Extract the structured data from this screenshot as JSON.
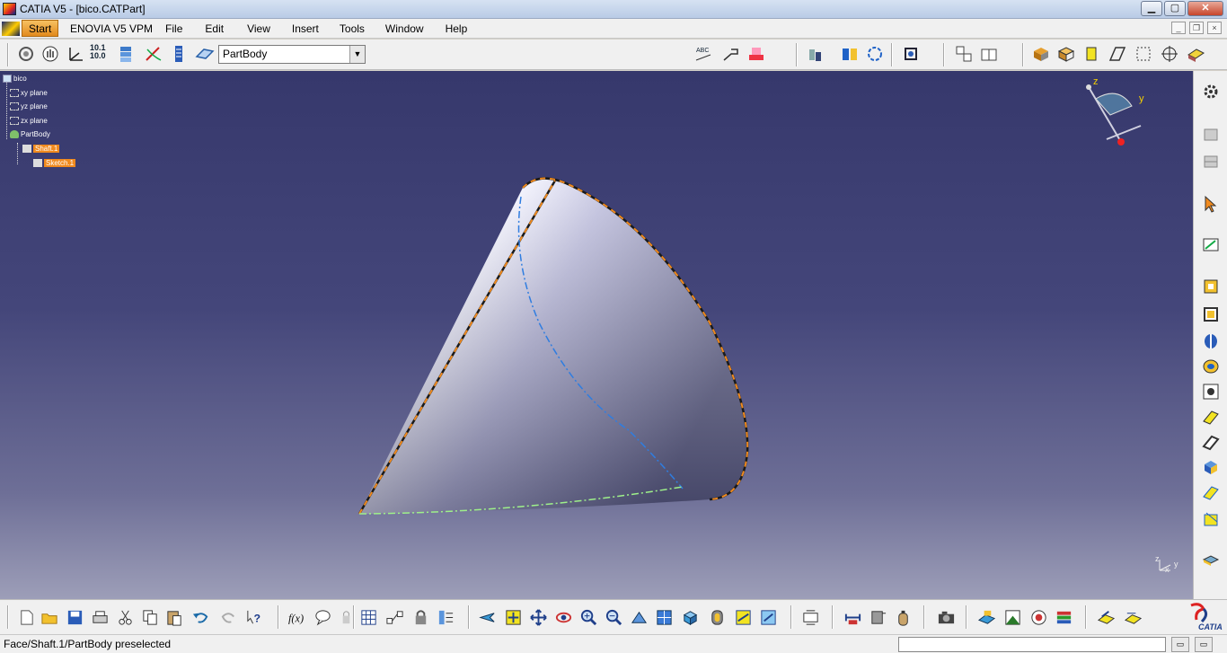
{
  "window": {
    "title": "CATIA V5 - [bico.CATPart]",
    "controls": [
      "▁",
      "▢",
      "✕"
    ]
  },
  "menu": {
    "start": "Start",
    "items": [
      "ENOVIA V5 VPM",
      "File",
      "Edit",
      "View",
      "Insert",
      "Tools",
      "Window",
      "Help"
    ],
    "mdi": [
      "_",
      "❐",
      "×"
    ]
  },
  "toolbar": {
    "body_selector": "PartBody",
    "scale_label_top": "10.1",
    "scale_label_bottom": "10.0"
  },
  "tree": {
    "root": "bico",
    "nodes": [
      "xy plane",
      "yz plane",
      "zx plane",
      "PartBody"
    ],
    "shaft": "Shaft.1",
    "sketch": "Sketch.1"
  },
  "compass": {
    "z": "z",
    "y": "y"
  },
  "mini_axis": {
    "z": "z",
    "x": "x",
    "y": "y"
  },
  "status": {
    "message": "Face/Shaft.1/PartBody preselected"
  },
  "colors": {
    "viewport_top": "#36386c",
    "viewport_bottom": "#9d9eb8",
    "selection": "#f08a1e"
  },
  "icons": {
    "top": [
      "sketcher-icon",
      "hand-icon",
      "axis-system-icon",
      "scale-icon",
      "stack-icon",
      "tangent-icon",
      "list-icon",
      "plane-icon"
    ],
    "bottom": [
      "new-icon",
      "open-icon",
      "save-icon",
      "print-icon",
      "cut-icon",
      "copy-icon",
      "paste-icon",
      "undo-icon",
      "redo-icon",
      "whats-this-icon"
    ]
  }
}
